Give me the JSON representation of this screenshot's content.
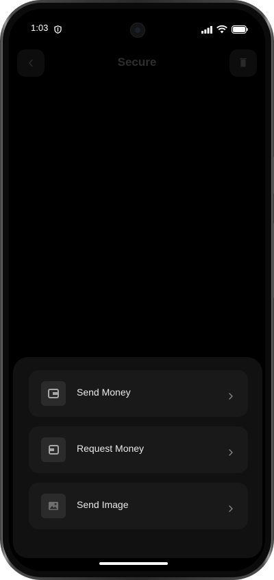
{
  "status_bar": {
    "time": "1:03",
    "icons": [
      "shield-icon",
      "signal-icon",
      "wifi-icon",
      "battery-icon"
    ]
  },
  "nav": {
    "title": "Secure",
    "icons": [
      "chevron-left-icon",
      "trash-icon"
    ]
  },
  "sheet": {
    "options": [
      {
        "label": "Send Money",
        "icon": "wallet-icon"
      },
      {
        "label": "Request Money",
        "icon": "request-icon"
      },
      {
        "label": "Send Image",
        "icon": "image-icon"
      }
    ]
  },
  "colors": {
    "background": "#000000",
    "sheet": "#111111",
    "option": "#191919",
    "text": "#e9e9e9"
  }
}
